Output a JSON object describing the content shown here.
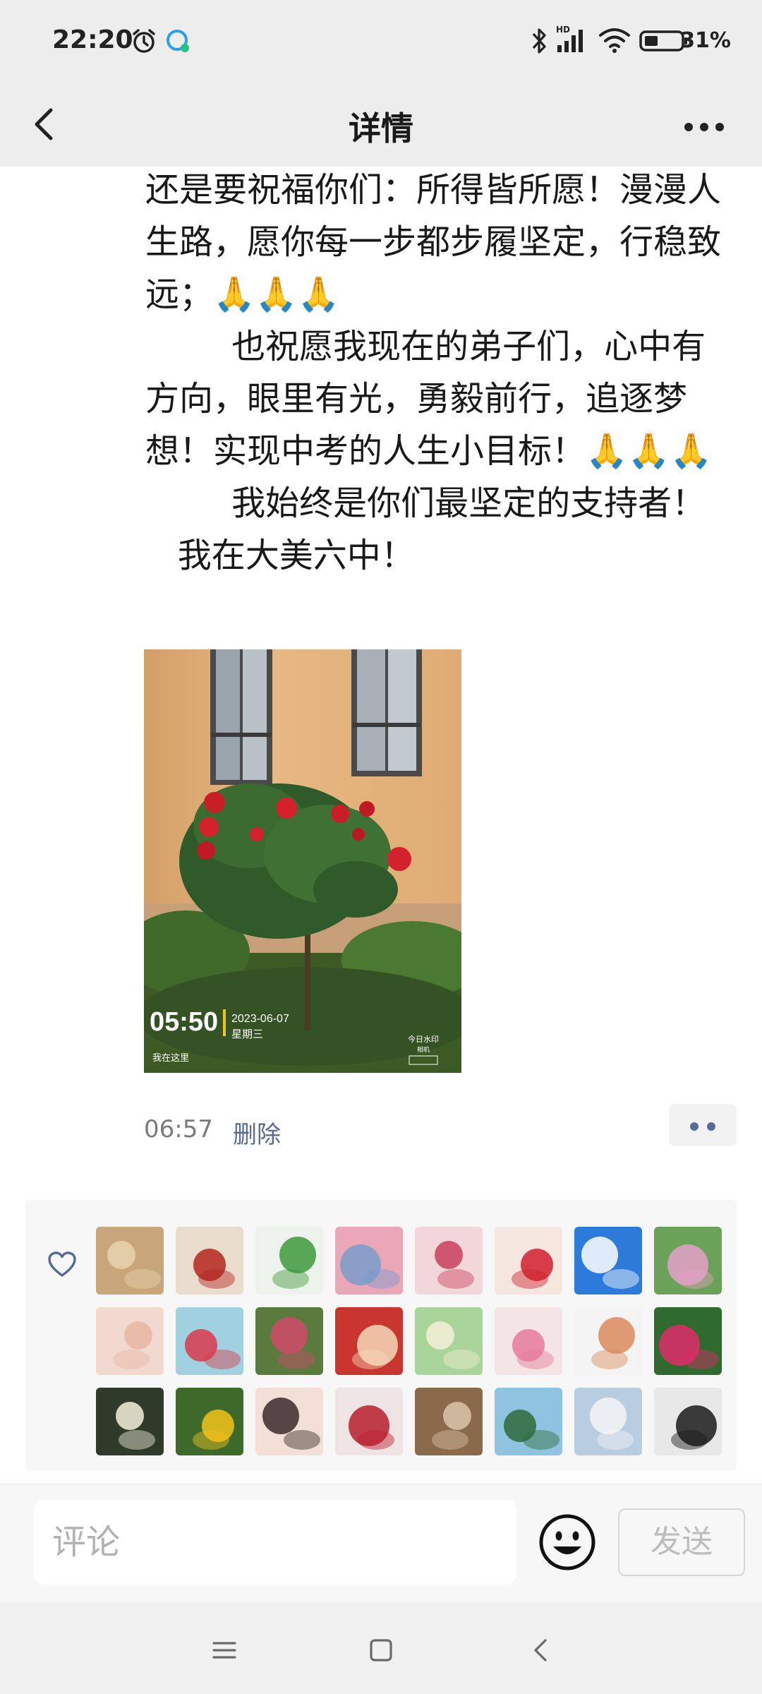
{
  "status_bar": {
    "time": "22:20",
    "icons": [
      "alarm-icon",
      "app-notification-icon",
      "bluetooth-icon",
      "hd-signal-icon",
      "wifi-icon",
      "battery-icon"
    ],
    "battery": "31%"
  },
  "nav": {
    "title": "详情",
    "back_icon": "chevron-left-icon",
    "more_icon": "more-dots-icon"
  },
  "post": {
    "paragraphs": [
      "还是要祝福你们：所得皆所愿！漫漫人生路，愿你每一步都步履坚定，行稳致远；🙏🙏🙏",
      "        也祝愿我现在的弟子们，心中有方向，眼里有光，勇毅前行，追逐梦想！实现中考的人生小目标！🙏🙏🙏",
      "        我始终是你们最坚定的支持者！",
      "   我在大美六中！"
    ],
    "photo": {
      "watermark_time": "05:50",
      "watermark_date": "2023-06-07",
      "watermark_weekday": "星期三",
      "watermark_location": "我在这里",
      "watermark_brand": "今日水印",
      "watermark_brand_sub": "相机"
    },
    "time": "06:57",
    "delete_label": "删除"
  },
  "likes": {
    "icon": "heart-outline-icon",
    "avatars": [
      {
        "name": "avatar-desert-landscape",
        "bg": "#c9a67a",
        "fg": "#e8d3b0"
      },
      {
        "name": "avatar-fu-character",
        "bg": "#e9dccc",
        "fg": "#b3261e"
      },
      {
        "name": "avatar-clover",
        "bg": "#eef2ec",
        "fg": "#3c9a3c"
      },
      {
        "name": "avatar-pink-tree",
        "bg": "#e9a7b8",
        "fg": "#7a9cc9"
      },
      {
        "name": "avatar-lily-flowers",
        "bg": "#f2d7da",
        "fg": "#c9405a"
      },
      {
        "name": "avatar-cartoon-girl",
        "bg": "#f5e7e0",
        "fg": "#d11f2d"
      },
      {
        "name": "avatar-blue-sky",
        "bg": "#2c7ad9",
        "fg": "#ffffff"
      },
      {
        "name": "avatar-garden-cat",
        "bg": "#6aa25a",
        "fg": "#e4a0c8"
      },
      {
        "name": "avatar-sleeping-baby",
        "bg": "#f2d9cf",
        "fg": "#e6b6a2"
      },
      {
        "name": "avatar-red-flowers-bowl",
        "bg": "#9fd1e0",
        "fg": "#d93a4a"
      },
      {
        "name": "avatar-rose-bush",
        "bg": "#5a7a3e",
        "fg": "#d14a6a"
      },
      {
        "name": "avatar-family-cartoon",
        "bg": "#c8362f",
        "fg": "#f6d7b8"
      },
      {
        "name": "avatar-girl-in-field",
        "bg": "#a9d49a",
        "fg": "#f3eed6"
      },
      {
        "name": "avatar-carnations",
        "bg": "#f3e4e6",
        "fg": "#e77b9a"
      },
      {
        "name": "avatar-family-illustration",
        "bg": "#f4f4f4",
        "fg": "#d98a5a"
      },
      {
        "name": "avatar-pink-rose",
        "bg": "#2f6a2f",
        "fg": "#e02a6a"
      },
      {
        "name": "avatar-water-lilies",
        "bg": "#2f3a2a",
        "fg": "#f4f0dc"
      },
      {
        "name": "avatar-sunflower",
        "bg": "#3d6a2a",
        "fg": "#f2c21a"
      },
      {
        "name": "avatar-girl-portrait",
        "bg": "#f3dfd6",
        "fg": "#3a2a2a"
      },
      {
        "name": "avatar-red-roses-bouquet",
        "bg": "#efe4e4",
        "fg": "#b81e2e"
      },
      {
        "name": "avatar-man-reading",
        "bg": "#8a6a4a",
        "fg": "#d9c4a8"
      },
      {
        "name": "avatar-palm-plant",
        "bg": "#8fc4e0",
        "fg": "#2f6a3a"
      },
      {
        "name": "avatar-beach-girl",
        "bg": "#b8cde0",
        "fg": "#f4f4f4"
      },
      {
        "name": "avatar-dancer",
        "bg": "#e8e8e8",
        "fg": "#1a1a1a"
      }
    ]
  },
  "comment_bar": {
    "placeholder": "评论",
    "emoji_icon": "emoji-smile-icon",
    "send_label": "发送"
  },
  "system_nav": {
    "icons": [
      "menu-icon",
      "home-square-icon",
      "back-chevron-icon"
    ]
  }
}
